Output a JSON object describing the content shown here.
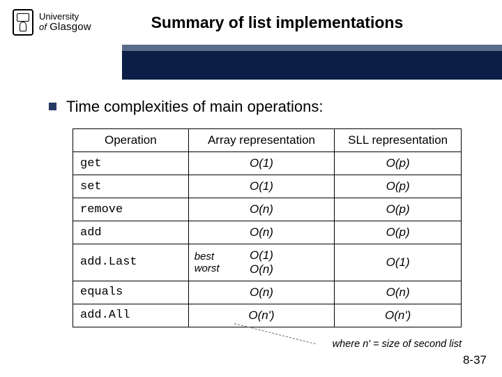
{
  "logo": {
    "line1": "University",
    "line2_prefix": "of ",
    "line2_name": "Glasgow"
  },
  "title": "Summary of list implementations",
  "bullet": "Time complexities of main operations:",
  "table": {
    "headers": {
      "op": "Operation",
      "arr": "Array representation",
      "sll": "SLL representation"
    },
    "bw": {
      "best": "best",
      "worst": "worst"
    },
    "rows": [
      {
        "op": "get",
        "arr": "O(1)",
        "sll": "O(p)"
      },
      {
        "op": "set",
        "arr": "O(1)",
        "sll": "O(p)"
      },
      {
        "op": "remove",
        "arr": "O(n)",
        "sll": "O(p)"
      },
      {
        "op": "add",
        "arr": "O(n)",
        "sll": "O(p)"
      },
      {
        "op": "add.Last",
        "arr_best": "O(1)",
        "arr_worst": "O(n)",
        "sll": "O(1)",
        "bw": true
      },
      {
        "op": "equals",
        "arr": "O(n)",
        "sll": "O(n)"
      },
      {
        "op": "add.All",
        "arr": "O(n')",
        "sll": "O(n')"
      }
    ]
  },
  "footnote": "where n' = size of second list",
  "pagenum": "8-37",
  "chart_data": {
    "type": "table",
    "title": "Time complexities of main operations",
    "columns": [
      "Operation",
      "Array representation",
      "SLL representation"
    ],
    "rows": [
      [
        "get",
        "O(1)",
        "O(p)"
      ],
      [
        "set",
        "O(1)",
        "O(p)"
      ],
      [
        "remove",
        "O(n)",
        "O(p)"
      ],
      [
        "add",
        "O(n)",
        "O(p)"
      ],
      [
        "add.Last",
        "best O(1) / worst O(n)",
        "O(1)"
      ],
      [
        "equals",
        "O(n)",
        "O(n)"
      ],
      [
        "add.All",
        "O(n')",
        "O(n')"
      ]
    ],
    "footnote": "where n' = size of second list"
  }
}
